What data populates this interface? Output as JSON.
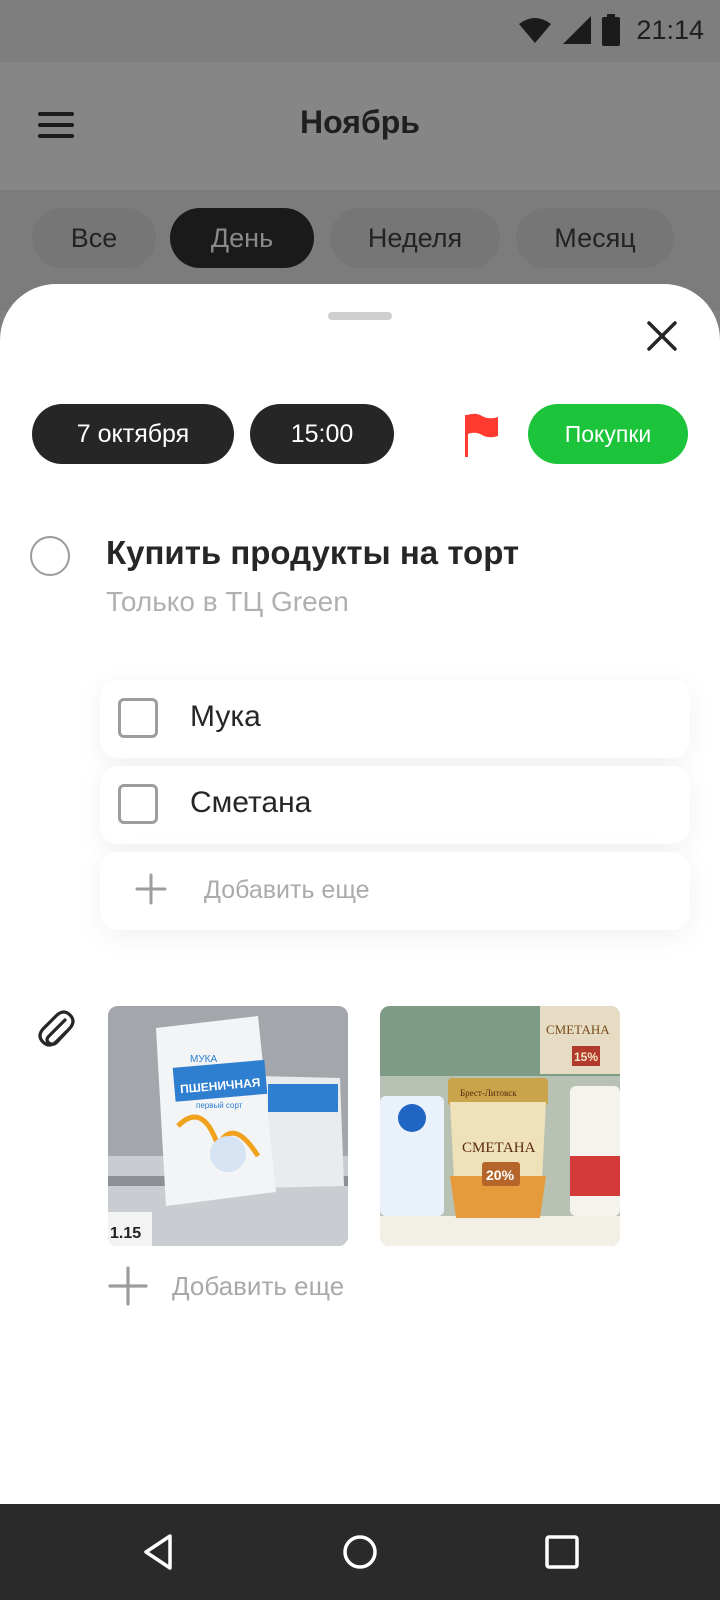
{
  "status": {
    "time": "21:14"
  },
  "header": {
    "title": "Ноябрь"
  },
  "filters": [
    {
      "label": "Все",
      "active": false
    },
    {
      "label": "День",
      "active": true
    },
    {
      "label": "Неделя",
      "active": false
    },
    {
      "label": "Месяц",
      "active": false
    }
  ],
  "sheet": {
    "date": "7 октября",
    "time": "15:00",
    "flag_color": "#ff3b30",
    "category": "Покупки",
    "category_color": "#1bc43a",
    "task": {
      "title": "Купить продукты на торт",
      "note": "Только в ТЦ Green",
      "completed": false
    },
    "subtasks": [
      {
        "label": "Мука",
        "checked": false
      },
      {
        "label": "Сметана",
        "checked": false
      }
    ],
    "add_subtask_label": "Добавить еще",
    "attachments": {
      "photos": [
        {
          "label_line1": "МУКА",
          "label_line2": "ПШЕНИЧНАЯ",
          "label_line3": "первый сорт",
          "price": "1.15"
        },
        {
          "brand": "Брест-Литовск",
          "product": "СМЕТАНА",
          "fat": "20%",
          "shelf_product": "СМЕТАНА",
          "shelf_fat": "15%"
        }
      ],
      "add_label": "Добавить еще"
    }
  }
}
